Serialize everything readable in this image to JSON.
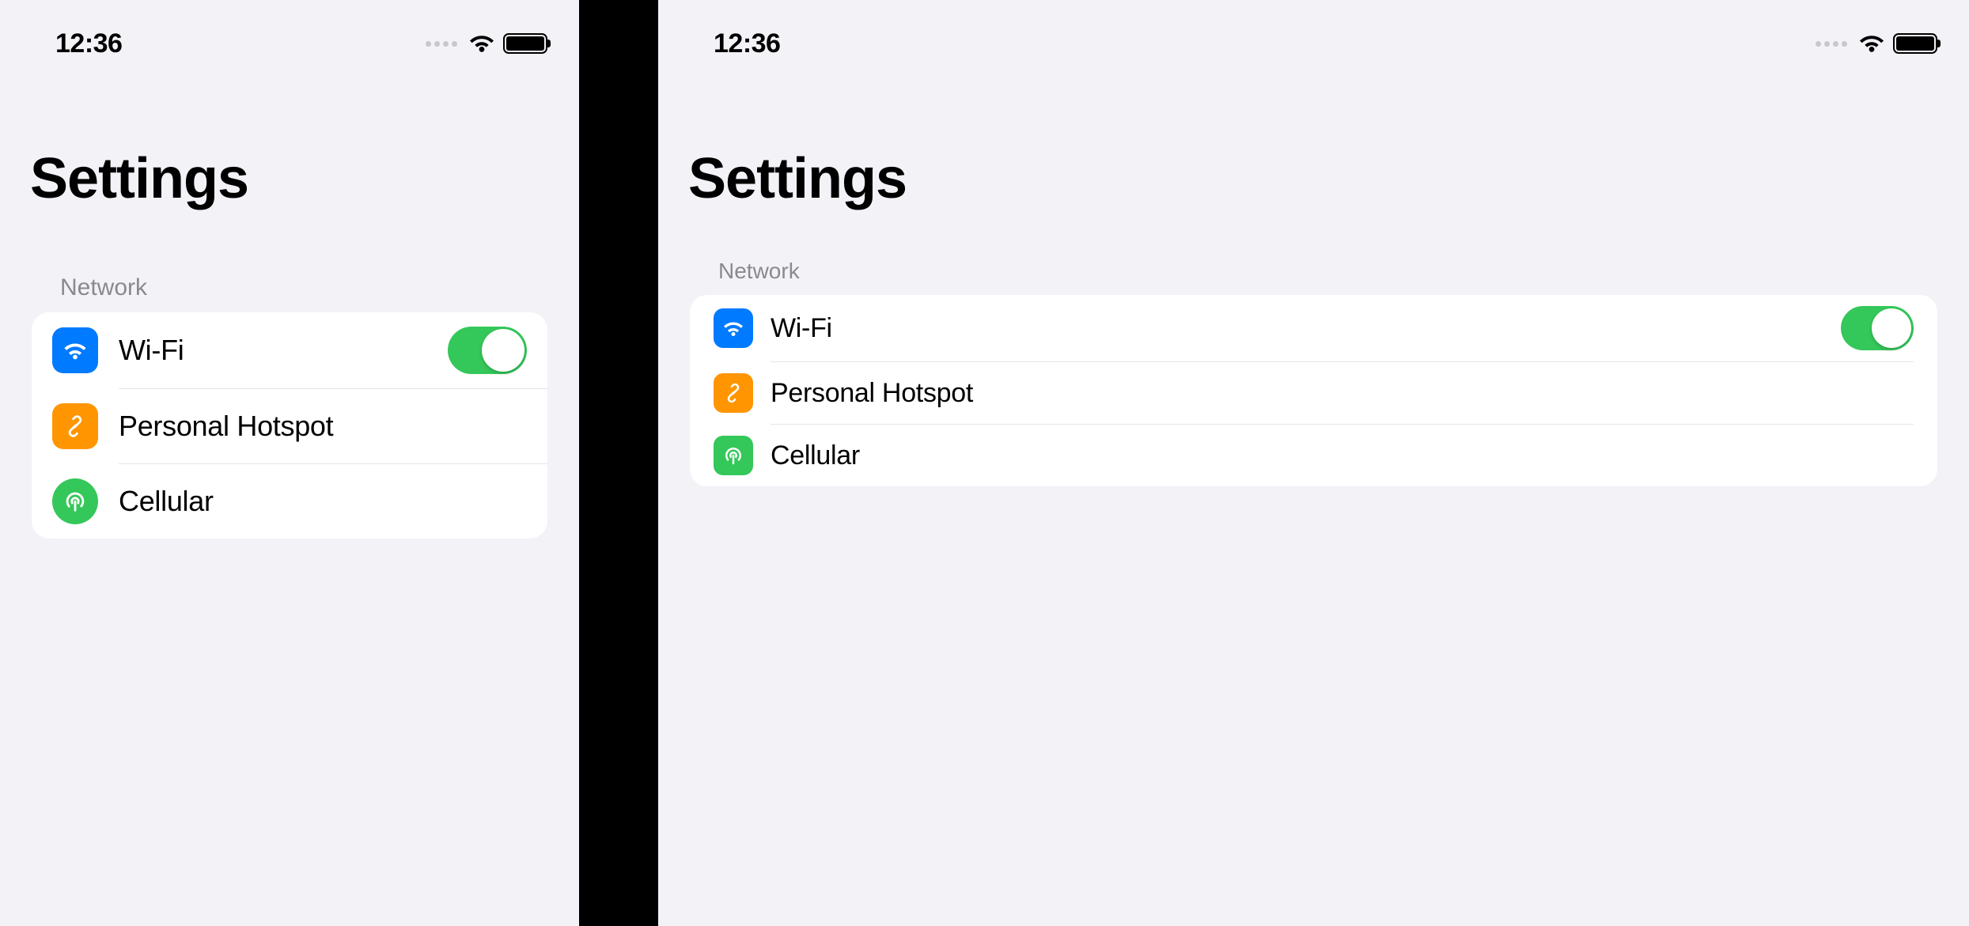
{
  "status_bar": {
    "time": "12:36"
  },
  "page_title": "Settings",
  "section": {
    "header": "Network",
    "rows": [
      {
        "label": "Wi-Fi",
        "icon": "wifi-icon",
        "icon_color": "#007aff",
        "toggle_on": true
      },
      {
        "label": "Personal Hotspot",
        "icon": "link-icon",
        "icon_color": "#ff9500"
      },
      {
        "label": "Cellular",
        "icon": "antenna-icon",
        "icon_color": "#34c759"
      }
    ]
  }
}
